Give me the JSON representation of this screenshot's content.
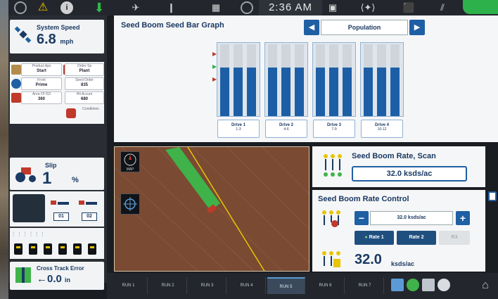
{
  "topbar": {
    "clock": "2:36 AM",
    "icons": [
      "status-circle-icon",
      "warning-icon",
      "info-icon",
      "download-arrow-icon",
      "satellite-icon",
      "pause-icon",
      "grid-icon",
      "power-icon",
      "clock-icon",
      "window-icon",
      "connector-icon",
      "tractor-icon",
      "sprayer-icon",
      "auto-steer-icon"
    ]
  },
  "left": {
    "system_speed": {
      "label": "System Speed",
      "value": "6.8",
      "unit": "mph"
    },
    "minigrid": [
      {
        "label": "Product Apx",
        "value": "Start"
      },
      {
        "label": "Order Sp",
        "value": "Plant"
      },
      {
        "label": "Front",
        "value": "Prime"
      },
      {
        "label": "Seed Order",
        "value": "835"
      },
      {
        "label": "Area Of IS3",
        "value": "360"
      },
      {
        "label": "Hit Accum",
        "value": "680"
      },
      {
        "label": "Conditions",
        "value": ""
      }
    ],
    "slip": {
      "label": "Slip",
      "value": "1",
      "unit": "%"
    },
    "devices": [
      "01",
      "02"
    ],
    "sections_count": 6,
    "cross_track": {
      "label": "Cross Track Error",
      "value": "0.0",
      "unit": "in",
      "direction": "←"
    }
  },
  "graph": {
    "title": "Seed Boom Seed Bar Graph",
    "selector": "Population",
    "drives": [
      {
        "name": "Drive 1",
        "rows": "1-3",
        "fill": [
          0.68,
          0.68,
          0.68
        ]
      },
      {
        "name": "Drive 2",
        "rows": "4-6",
        "fill": [
          0.68,
          0.68,
          0.68
        ]
      },
      {
        "name": "Drive 3",
        "rows": "7-9",
        "fill": [
          0.68,
          0.68,
          0.68
        ]
      },
      {
        "name": "Drive 4",
        "rows": "10-12",
        "fill": [
          0.68,
          0.68,
          0.68
        ]
      }
    ]
  },
  "map": {
    "north_label": "MAP"
  },
  "rate_scan": {
    "title": "Seed Boom Rate, Scan",
    "value": "32.0 ksds/ac"
  },
  "rate_control": {
    "title": "Seed Boom Rate Control",
    "target": "32.0 ksds/ac",
    "rate1": "Rate 1",
    "rate2": "Rate 2",
    "rate3": "R3",
    "actual_value": "32.0",
    "actual_unit": "ksds/ac"
  },
  "bottom": {
    "runs": [
      "RUN 1",
      "RUN 2",
      "RUN 3",
      "RUN 4",
      "RUN 5",
      "RUN 6",
      "RUN 7"
    ],
    "active_run": 4
  },
  "colors": {
    "brand_blue": "#1f5fa3",
    "dark_navy": "#1b3a63",
    "soil": "#7a4a33",
    "guidance_green": "#3fb34a",
    "status_green": "#2db14a"
  }
}
